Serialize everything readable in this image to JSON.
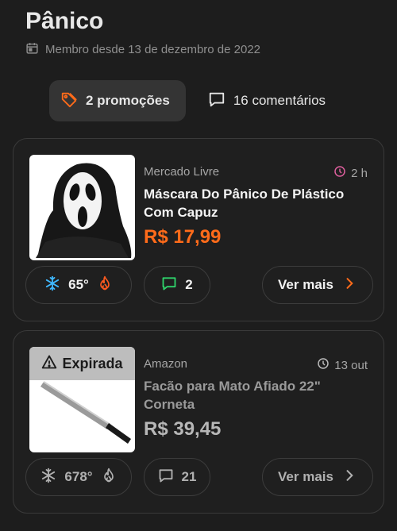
{
  "page": {
    "title": "Pânico",
    "member_since": "Membro desde 13 de dezembro de 2022"
  },
  "tabs": [
    {
      "label": "2 promoções",
      "icon": "tag-icon",
      "active": true
    },
    {
      "label": "16 comentários",
      "icon": "comment-icon",
      "active": false
    }
  ],
  "deals": [
    {
      "store": "Mercado Livre",
      "time": "2 h",
      "title": "Máscara Do Pânico De Plástico Com Capuz",
      "price": "R$ 17,99",
      "temperature": "65°",
      "comments": "2",
      "more_label": "Ver mais",
      "expired": false
    },
    {
      "store": "Amazon",
      "time": "13 out",
      "title": "Facão para Mato Afiado 22\" Corneta",
      "price": "R$ 39,45",
      "temperature": "678°",
      "comments": "21",
      "more_label": "Ver mais",
      "expired": true,
      "badge": "Expirada"
    }
  ],
  "colors": {
    "accent": "#ff6b1a",
    "hot": "#ff5a1f",
    "cold": "#3fb8ff",
    "comment": "#2fd36b",
    "clock_active": "#e0609f"
  }
}
